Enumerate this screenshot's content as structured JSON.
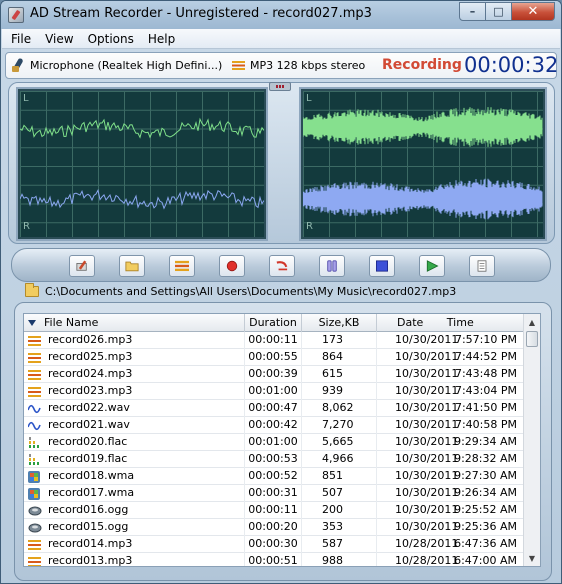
{
  "window": {
    "title": "AD Stream Recorder - Unregistered - record027.mp3",
    "minimize_glyph": "–",
    "maximize_glyph": "□",
    "close_glyph": "✕"
  },
  "menu": [
    "File",
    "View",
    "Options",
    "Help"
  ],
  "status": {
    "source": "Microphone (Realtek High Defini...)",
    "format": "MP3 128 kbps stereo",
    "state": "Recording",
    "timer": "00:00:32",
    "state_color": "#d24a35",
    "timer_color": "#10308f"
  },
  "scopes": {
    "channel_left_label": "L",
    "channel_right_label": "R",
    "left_wave_color": "#7fe08a",
    "right_wave_color": "#8aa7f0",
    "right_top_color": "#86e08e",
    "right_bottom_color": "#8ea9f2"
  },
  "toolbar": [
    {
      "name": "settings-button",
      "icon": "settings-icon"
    },
    {
      "name": "open-folder-button",
      "icon": "folder-icon"
    },
    {
      "name": "format-button",
      "icon": "format-icon"
    },
    {
      "name": "record-button",
      "icon": "record-icon"
    },
    {
      "name": "undo-button",
      "icon": "undo-icon"
    },
    {
      "name": "pause-button",
      "icon": "pause-icon"
    },
    {
      "name": "stop-button",
      "icon": "stop-icon"
    },
    {
      "name": "play-button",
      "icon": "play-icon"
    },
    {
      "name": "notes-button",
      "icon": "notes-icon"
    }
  ],
  "path": "C:\\Documents and Settings\\All Users\\Documents\\My Music\\record027.mp3",
  "list": {
    "columns": [
      "File Name",
      "Duration",
      "Size,KB",
      "Date",
      "Time"
    ],
    "rows": [
      {
        "name": "record026.mp3",
        "type": "mp3",
        "duration": "00:00:11",
        "size": "173",
        "date": "10/30/2011",
        "time": "7:57:10 PM"
      },
      {
        "name": "record025.mp3",
        "type": "mp3",
        "duration": "00:00:55",
        "size": "864",
        "date": "10/30/2011",
        "time": "7:44:52 PM"
      },
      {
        "name": "record024.mp3",
        "type": "mp3",
        "duration": "00:00:39",
        "size": "615",
        "date": "10/30/2011",
        "time": "7:43:48 PM"
      },
      {
        "name": "record023.mp3",
        "type": "mp3",
        "duration": "00:01:00",
        "size": "939",
        "date": "10/30/2011",
        "time": "7:43:04 PM"
      },
      {
        "name": "record022.wav",
        "type": "wav",
        "duration": "00:00:47",
        "size": "8,062",
        "date": "10/30/2011",
        "time": "7:41:50 PM"
      },
      {
        "name": "record021.wav",
        "type": "wav",
        "duration": "00:00:42",
        "size": "7,270",
        "date": "10/30/2011",
        "time": "7:40:58 PM"
      },
      {
        "name": "record020.flac",
        "type": "flac",
        "duration": "00:01:00",
        "size": "5,665",
        "date": "10/30/2011",
        "time": "9:29:34 AM"
      },
      {
        "name": "record019.flac",
        "type": "flac",
        "duration": "00:00:53",
        "size": "4,966",
        "date": "10/30/2011",
        "time": "9:28:32 AM"
      },
      {
        "name": "record018.wma",
        "type": "wma",
        "duration": "00:00:52",
        "size": "851",
        "date": "10/30/2011",
        "time": "9:27:30 AM"
      },
      {
        "name": "record017.wma",
        "type": "wma",
        "duration": "00:00:31",
        "size": "507",
        "date": "10/30/2011",
        "time": "9:26:34 AM"
      },
      {
        "name": "record016.ogg",
        "type": "ogg",
        "duration": "00:00:11",
        "size": "200",
        "date": "10/30/2011",
        "time": "9:25:52 AM"
      },
      {
        "name": "record015.ogg",
        "type": "ogg",
        "duration": "00:00:20",
        "size": "353",
        "date": "10/30/2011",
        "time": "9:25:36 AM"
      },
      {
        "name": "record014.mp3",
        "type": "mp3",
        "duration": "00:00:30",
        "size": "587",
        "date": "10/28/2011",
        "time": "6:47:36 AM"
      },
      {
        "name": "record013.mp3",
        "type": "mp3",
        "duration": "00:00:51",
        "size": "988",
        "date": "10/28/2011",
        "time": "6:47:00 AM"
      }
    ]
  }
}
